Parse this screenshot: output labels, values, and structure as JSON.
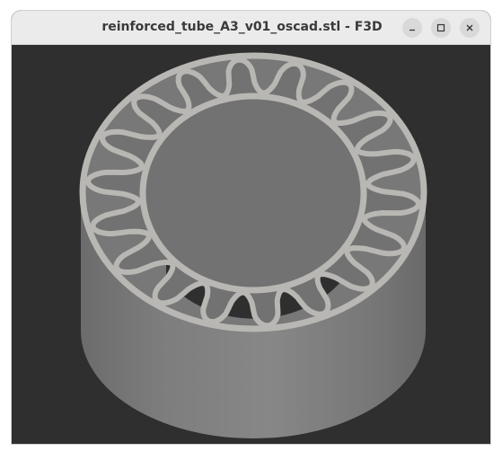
{
  "window": {
    "title": "reinforced_tube_A3_v01_oscad.stl - F3D",
    "controls": {
      "minimize_icon": "minimize-icon",
      "maximize_icon": "maximize-icon",
      "close_icon": "close-icon"
    }
  },
  "viewport": {
    "background_color": "#2f2f2f",
    "model": {
      "name": "reinforced-tube",
      "body_color": "#7a7a7a",
      "wall_color": "#b8b7b3",
      "wave_lobe_count": 18
    }
  }
}
